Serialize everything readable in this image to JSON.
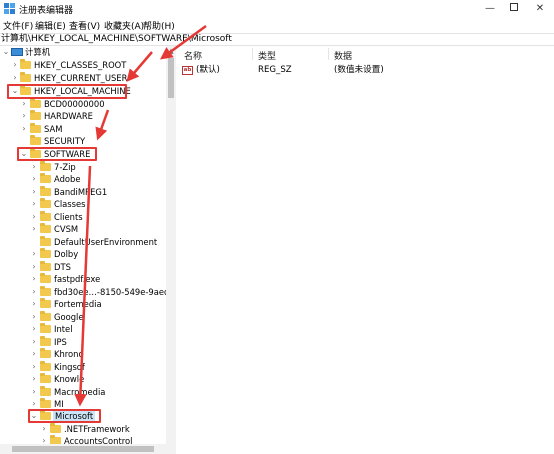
{
  "window": {
    "title": "注册表编辑器",
    "minimize_glyph": "—",
    "close_glyph": "✕"
  },
  "menu": [
    "文件(F)",
    "编辑(E)",
    "查看(V)",
    "收藏夹(A)",
    "帮助(H)"
  ],
  "address": "计算机\\HKEY_LOCAL_MACHINE\\SOFTWARE\\Microsoft",
  "tree": {
    "root": "计算机",
    "hives": [
      "HKEY_CLASSES_ROOT",
      "HKEY_CURRENT_USER",
      "HKEY_LOCAL_MACHINE"
    ],
    "hklm_children": [
      "BCD00000000",
      "HARDWARE",
      "SAM",
      "SECURITY",
      "SOFTWARE"
    ],
    "software_children": [
      "7-Zip",
      "Adobe",
      "BandiMPEG1",
      "Classes",
      "Clients",
      "CVSM",
      "DefaultUserEnvironment",
      "Dolby",
      "DTS",
      "fastpdf.exe",
      "fbd30ee…-8150-549e-9aed-fd9",
      "Fortemedia",
      "Google",
      "Intel",
      "IPS",
      "Khrono",
      "Kingsof",
      "Knowle",
      "Macromedia",
      "MI",
      "Microsoft"
    ],
    "microsoft_children": [
      ".NETFramework",
      "AccountsControl"
    ]
  },
  "list": {
    "columns": [
      "名称",
      "类型",
      "数据"
    ],
    "rows": [
      {
        "name": "(默认)",
        "type": "REG_SZ",
        "data": "(数值未设置)",
        "icon": "ab-string-icon"
      }
    ]
  },
  "annotation_color": "#e53935"
}
